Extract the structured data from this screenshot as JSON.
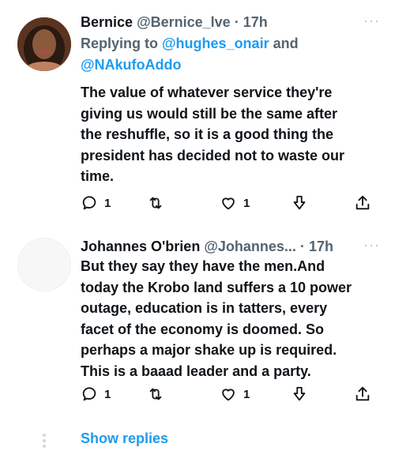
{
  "tweets": [
    {
      "name": "Bernice",
      "handle": "@Bernice_lve",
      "separator": "·",
      "time": "17h",
      "more": "···",
      "replying_prefix": "Replying to ",
      "mention_1": "@hughes_onair",
      "replying_and": " and",
      "mention_2": "@NAkufoAddo",
      "body_lines": [
        "The value of whatever service they're",
        "giving us would still be the same after",
        "the reshuffle, so it is a good thing the",
        "president has decided not to waste our",
        "time."
      ],
      "reply_count": "1",
      "retweet_count": "",
      "like_count": "1"
    },
    {
      "name": "Johannes O'brien",
      "handle": "@Johannes...",
      "separator": "·",
      "time": "17h",
      "more": "···",
      "body_lines": [
        "But they say they have the men.And",
        "today the Krobo land suffers a 10 power",
        "outage, education is in tatters, every",
        "facet of the economy is doomed. So",
        "perhaps a major shake up is required.",
        "This is a baaad leader and a party."
      ],
      "reply_count": "1",
      "retweet_count": "",
      "like_count": "1"
    }
  ],
  "show_replies": "Show replies",
  "colors": {
    "link": "#1d9bf0",
    "muted": "#536471",
    "text": "#0f1419"
  },
  "icons": {
    "reply": "reply-icon",
    "retweet": "retweet-icon",
    "like": "heart-icon",
    "downvote": "arrow-down-icon",
    "share": "share-icon"
  }
}
